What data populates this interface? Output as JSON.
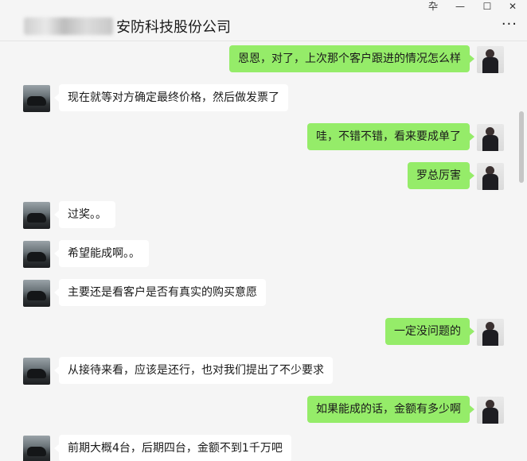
{
  "window": {
    "title": "安防科技股份公司",
    "controls": {
      "pin": "卆",
      "minimize": "—",
      "maximize": "☐",
      "close": "✕"
    },
    "more": "···"
  },
  "messages": [
    {
      "side": "right",
      "text": "恩恩，对了，上次那个客户跟进的情况怎么样"
    },
    {
      "side": "left",
      "text": "现在就等对方确定最终价格，然后做发票了"
    },
    {
      "side": "right",
      "text": "哇，不错不错，看来要成单了"
    },
    {
      "side": "right",
      "text": "罗总厉害"
    },
    {
      "side": "left",
      "text": "过奖。。"
    },
    {
      "side": "left",
      "text": "希望能成啊。。"
    },
    {
      "side": "left",
      "text": "主要还是看客户是否有真实的购买意愿"
    },
    {
      "side": "right",
      "text": "一定没问题的"
    },
    {
      "side": "left",
      "text": "从接待来看，应该是还行，也对我们提出了不少要求"
    },
    {
      "side": "right",
      "text": "如果能成的话，金额有多少啊"
    },
    {
      "side": "left",
      "text": "前期大概4台，后期四台，金额不到1千万吧"
    }
  ]
}
